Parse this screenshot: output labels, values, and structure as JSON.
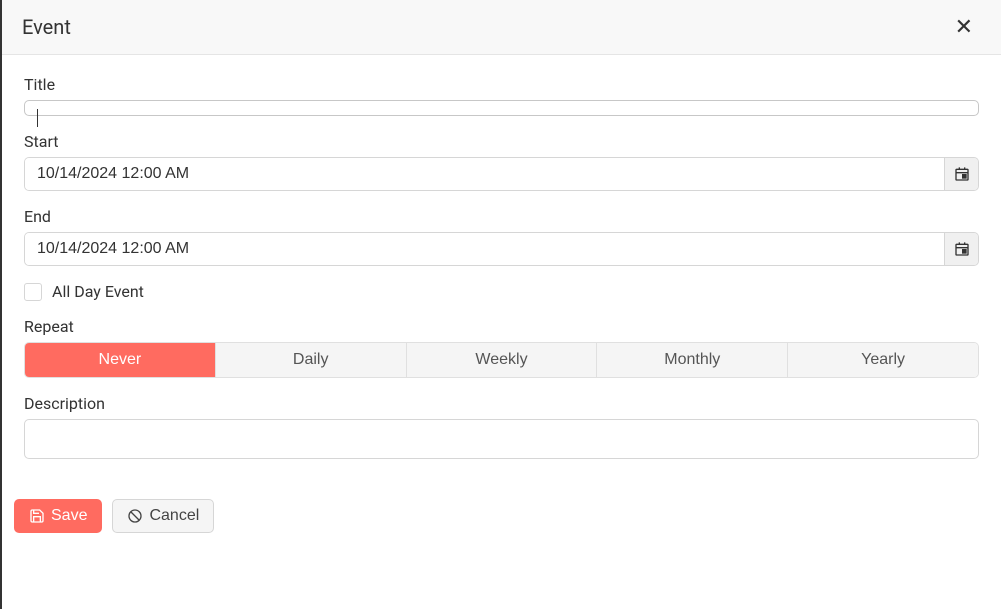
{
  "header": {
    "title": "Event"
  },
  "form": {
    "title": {
      "label": "Title",
      "value": ""
    },
    "start": {
      "label": "Start",
      "value": "10/14/2024 12:00 AM"
    },
    "end": {
      "label": "End",
      "value": "10/14/2024 12:00 AM"
    },
    "allDay": {
      "label": "All Day Event",
      "checked": false
    },
    "repeat": {
      "label": "Repeat",
      "options": [
        "Never",
        "Daily",
        "Weekly",
        "Monthly",
        "Yearly"
      ],
      "selected": "Never"
    },
    "description": {
      "label": "Description",
      "value": ""
    }
  },
  "footer": {
    "save": "Save",
    "cancel": "Cancel"
  }
}
